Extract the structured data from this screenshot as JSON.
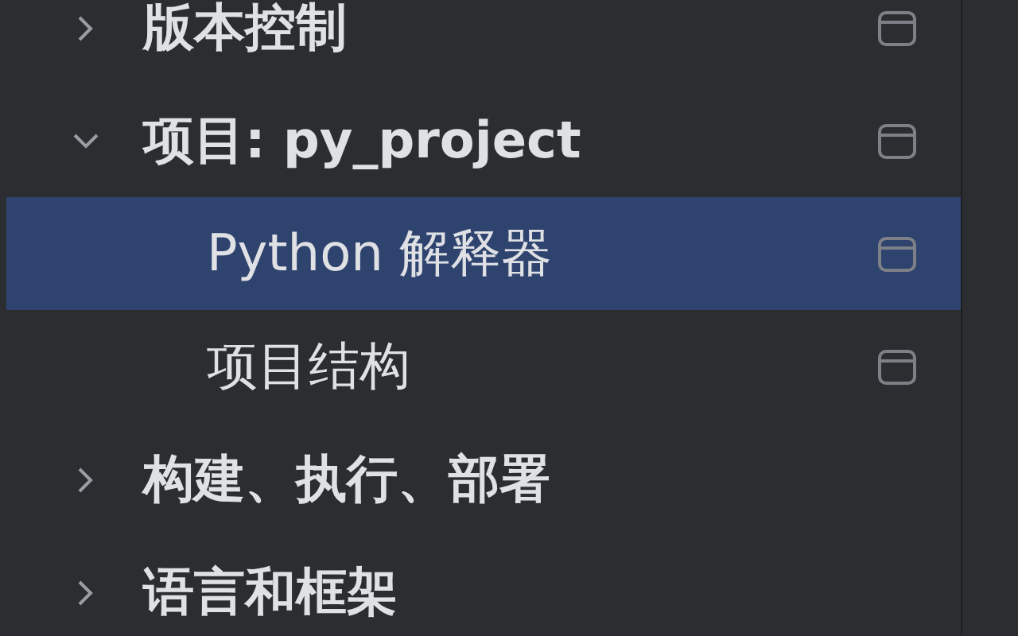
{
  "settings_tree": [
    {
      "label": "版本控制",
      "expanded": false,
      "selected": false,
      "project_icon": true
    },
    {
      "label": "项目: py_project",
      "expanded": true,
      "selected": false,
      "project_icon": true,
      "children": [
        {
          "label": "Python 解释器",
          "selected": true,
          "project_icon": true
        },
        {
          "label": "项目结构",
          "selected": false,
          "project_icon": true
        }
      ]
    },
    {
      "label": "构建、执行、部署",
      "expanded": false,
      "selected": false,
      "project_icon": false
    },
    {
      "label": "语言和框架",
      "expanded": false,
      "selected": false,
      "project_icon": false
    }
  ]
}
